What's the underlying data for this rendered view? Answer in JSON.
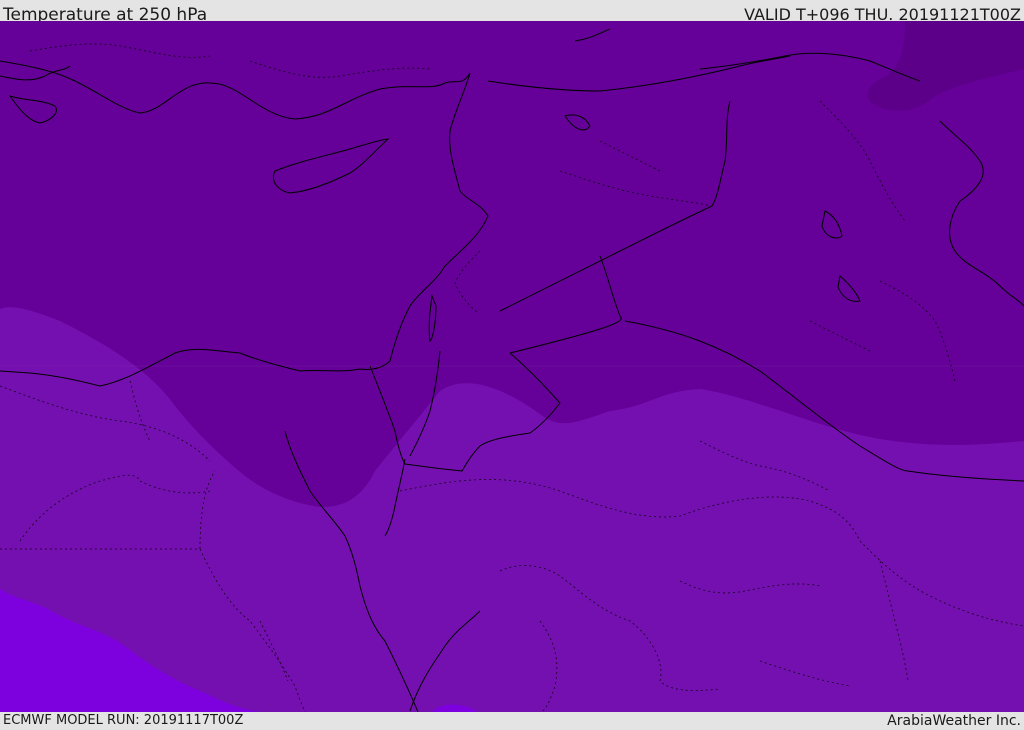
{
  "header": {
    "title": "Temperature at 250 hPa",
    "valid_time": "VALID T+096 THU. 20191121T00Z"
  },
  "footer": {
    "model_run": "ECMWF MODEL RUN: 20191117T00Z",
    "credit": "ArabiaWeather Inc."
  },
  "map": {
    "colors": {
      "cold_zone": "#5c0089",
      "main_zone": "#650198",
      "warm_zone": "#7510b0",
      "warmest_zone": "#7d00de",
      "coastline": "#000000"
    }
  }
}
